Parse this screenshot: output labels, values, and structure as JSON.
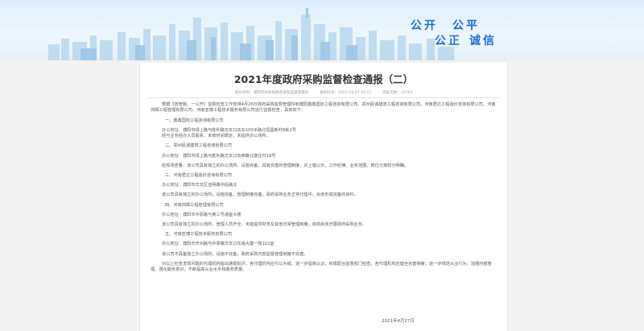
{
  "banner": {
    "slogan": [
      "公开",
      "公平",
      "公正",
      "诚信"
    ],
    "colors": {
      "sky": "#e4f1fa",
      "buildings": "#a9cde8",
      "slogan": "#1d6fd0"
    }
  },
  "article": {
    "title": "2021年度政府采购监督检查通报（二）",
    "meta": {
      "source": "发布机构：",
      "source_detail": "濮阳市财政局政府采购监督管理科",
      "date_label": "发布时间：",
      "date": "2021-04-27 16:17",
      "views_label": "浏览次数：",
      "views": "10763"
    },
    "intro": "根据《放管服、一公开》监督检查工作安排4月26日政府采购监督管理科到濮阳鑫鼎国际工程咨询有限公司、郑州民诚建筑工程咨询有限公司、河南君达工程造价咨询有限公司、河南鸿辉工程管理有限公司、河南亚博工程技术服务有限公司进行监督检查，具体如下：",
    "sections": [
      {
        "heading": "一、鼎鑫国际工程咨询有限公司",
        "lines": [
          "办公地址：濮阳市绿上路与胜利路交叉口向东100米路北恒昌新村8栋1号",
          "经与业务经办人员联系，未按时间限定，未提供办公场所。"
        ]
      },
      {
        "heading": "二、郑州民诚建筑工程咨询有限公司",
        "lines": [
          "办公地址：濮阳市绿上路与胜利路交叉口向西路北康庄村18号",
          "经现场查看，该公司具有独立的办公场所，设施完备，具有完善的管理制度，并上墙公示，工作纪律、业务范围、岗位分离较分明确。"
        ]
      },
      {
        "heading": "三、河南君达工程造价咨询有限公司",
        "lines": [
          "办公地址：濮阳市华龙区亚明路中段路北",
          "该公司具有独立的办公场所，设施完备，管理制度完备，政府采购业务正常代理中，尚未形成完备的资料。"
        ]
      },
      {
        "heading": "四、河南鸿辉工程管理有限公司",
        "lines": [
          "办公地址：濮阳市中原路与黄三号通首大楼",
          "该公司具有独立的办公场所，管理人员齐全，未能提供财务及其他日常管理制度，目前尚未开展政府采购业务。"
        ]
      },
      {
        "heading": "五、河南亚博工程技术服务有限公司",
        "lines": [
          "办公地址：濮阳市开州路与中原路交叉口东南大厦一楼102室",
          "该公司不具备独立办公场所，设施不完备，政府采购内部监督管理制度不完善。"
        ]
      }
    ],
    "closing": "对以上检查发现问题的代理机构提出通报批评，各代理机构应引以为戒，进一步提高认识，积极配合监督部门检查。各代理机构应健全完善制度，进一步规范从业行为，加强内部管理，强化服务意识，不断提高从业水平和服务质量。",
    "date": "2021年4月27日"
  }
}
